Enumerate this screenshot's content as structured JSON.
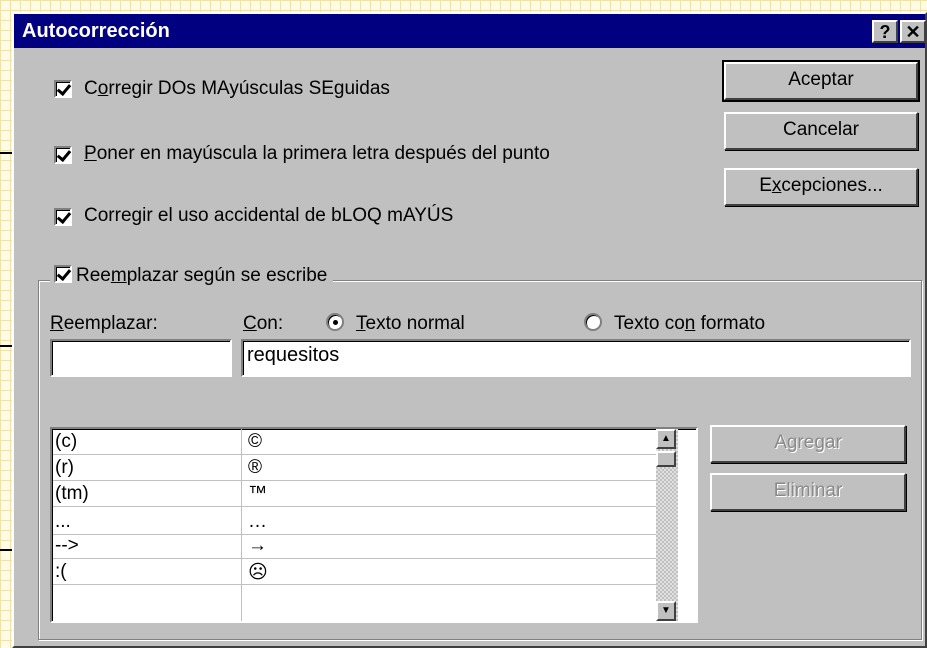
{
  "window": {
    "title": "Autocorrección",
    "help_label": "?",
    "close_label": "✕"
  },
  "options": [
    {
      "label_pre": "C",
      "label_u": "o",
      "label_post": "rregir DOs MAyúsculas SEguidas",
      "checked": true
    },
    {
      "label_pre": "",
      "label_u": "P",
      "label_post": "oner en mayúscula la primera letra después del punto",
      "checked": true
    },
    {
      "label_pre": "Corre",
      "label_u": "g",
      "label_post": "ir el uso accidental de bLOQ mAYÚS",
      "checked": true
    }
  ],
  "buttons": {
    "accept": "Aceptar",
    "cancel": "Cancelar",
    "exceptions_pre": "E",
    "exceptions_u": "x",
    "exceptions_post": "cepciones...",
    "add": "Agregar",
    "delete": "Eliminar"
  },
  "replace_group": {
    "title_pre": "Ree",
    "title_u": "m",
    "title_post": "plazar según se escribe",
    "checked": true,
    "replace_label_u": "R",
    "replace_label_post": "eemplazar:",
    "with_label_u": "C",
    "with_label_post": "on:",
    "plain_text_u": "T",
    "plain_text_post": "exto normal",
    "formatted_pre": "Texto co",
    "formatted_u": "n",
    "formatted_post": " formato",
    "selected_mode": "plain",
    "replace_value": "",
    "with_value": "requesitos"
  },
  "entries": [
    {
      "from": "(c)",
      "to": "©"
    },
    {
      "from": "(r)",
      "to": "®"
    },
    {
      "from": "(tm)",
      "to": "™"
    },
    {
      "from": "...",
      "to": "…"
    },
    {
      "from": "-->",
      "to": "→"
    },
    {
      "from": ":(",
      "to": "☹"
    }
  ],
  "scroll_icons": {
    "up": "triangle-up-icon",
    "down": "triangle-down-icon"
  }
}
